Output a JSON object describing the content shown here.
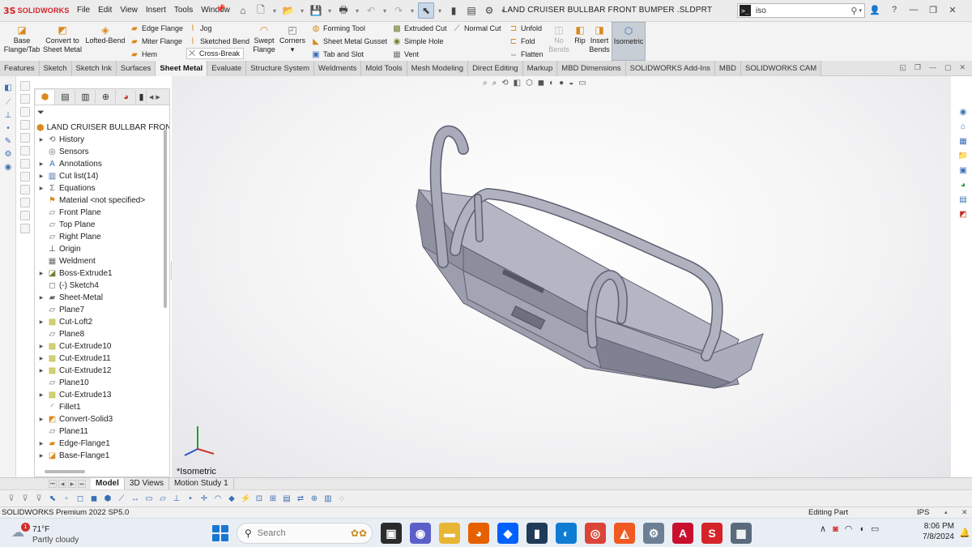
{
  "app": {
    "logo_mark": "3S",
    "logo_text": "SOLIDWORKS",
    "document_title": "LAND CRUISER BULLBAR FRONT BUMPER .SLDPRT"
  },
  "menus": [
    "File",
    "Edit",
    "View",
    "Insert",
    "Tools",
    "Window"
  ],
  "search": {
    "value": "iso",
    "placeholder": ""
  },
  "command_manager": {
    "base_flange": "Base Flange/Tab",
    "convert": "Convert to Sheet Metal",
    "lofted_bend": "Lofted-Bend",
    "edge_flange": "Edge Flange",
    "miter_flange": "Miter Flange",
    "hem": "Hem",
    "jog": "Jog",
    "sketched_bend": "Sketched Bend",
    "cross_break": "Cross-Break",
    "swept_flange": "Swept Flange",
    "corners": "Corners",
    "forming_tool": "Forming Tool",
    "gusset": "Sheet Metal Gusset",
    "tab_slot": "Tab and Slot",
    "extruded_cut": "Extruded Cut",
    "simple_hole": "Simple Hole",
    "vent": "Vent",
    "normal_cut": "Normal Cut",
    "unfold": "Unfold",
    "fold": "Fold",
    "flatten": "Flatten",
    "no_bends": "No Bends",
    "rip": "Rip",
    "insert_bends": "Insert Bends",
    "isometric": "Isometric"
  },
  "tabs": [
    {
      "label": "Features"
    },
    {
      "label": "Sketch"
    },
    {
      "label": "Sketch Ink"
    },
    {
      "label": "Surfaces"
    },
    {
      "label": "Sheet Metal",
      "active": true
    },
    {
      "label": "Evaluate"
    },
    {
      "label": "Structure System"
    },
    {
      "label": "Weldments"
    },
    {
      "label": "Mold Tools"
    },
    {
      "label": "Mesh Modeling"
    },
    {
      "label": "Direct Editing"
    },
    {
      "label": "Markup"
    },
    {
      "label": "MBD Dimensions"
    },
    {
      "label": "SOLIDWORKS Add-Ins"
    },
    {
      "label": "MBD"
    },
    {
      "label": "SOLIDWORKS CAM"
    }
  ],
  "tree": {
    "root": "LAND CRUISER BULLBAR FRONT B",
    "items": [
      {
        "label": "History",
        "icon": "history-icon",
        "exp": true
      },
      {
        "label": "Sensors",
        "icon": "sensors-icon",
        "exp": false
      },
      {
        "label": "Annotations",
        "icon": "annotations-icon",
        "exp": true
      },
      {
        "label": "Cut list(14)",
        "icon": "cutlist-icon",
        "exp": true
      },
      {
        "label": "Equations",
        "icon": "equations-icon",
        "exp": true
      },
      {
        "label": "Material <not specified>",
        "icon": "material-icon",
        "exp": false
      },
      {
        "label": "Front Plane",
        "icon": "plane-icon",
        "exp": false
      },
      {
        "label": "Top Plane",
        "icon": "plane-icon",
        "exp": false
      },
      {
        "label": "Right Plane",
        "icon": "plane-icon",
        "exp": false
      },
      {
        "label": "Origin",
        "icon": "origin-icon",
        "exp": false
      },
      {
        "label": "Weldment",
        "icon": "weldment-icon",
        "exp": false
      },
      {
        "label": "Boss-Extrude1",
        "icon": "boss-extrude-icon",
        "exp": true
      },
      {
        "label": "(-) Sketch4",
        "icon": "sketch-icon",
        "exp": false
      },
      {
        "label": "Sheet-Metal",
        "icon": "sheet-metal-icon",
        "exp": true
      },
      {
        "label": "Plane7",
        "icon": "plane-icon",
        "exp": false
      },
      {
        "label": "Cut-Loft2",
        "icon": "cut-icon",
        "exp": true
      },
      {
        "label": "Plane8",
        "icon": "plane-icon",
        "exp": false
      },
      {
        "label": "Cut-Extrude10",
        "icon": "cut-icon",
        "exp": true
      },
      {
        "label": "Cut-Extrude11",
        "icon": "cut-icon",
        "exp": true
      },
      {
        "label": "Cut-Extrude12",
        "icon": "cut-icon",
        "exp": true
      },
      {
        "label": "Plane10",
        "icon": "plane-icon",
        "exp": false
      },
      {
        "label": "Cut-Extrude13",
        "icon": "cut-icon",
        "exp": true
      },
      {
        "label": "Fillet1",
        "icon": "fillet-icon",
        "exp": false
      },
      {
        "label": "Convert-Solid3",
        "icon": "convert-icon",
        "exp": true
      },
      {
        "label": "Plane11",
        "icon": "plane-icon",
        "exp": false
      },
      {
        "label": "Edge-Flange1",
        "icon": "edge-flange-icon",
        "exp": true
      },
      {
        "label": "Base-Flange1",
        "icon": "base-flange-icon",
        "exp": true
      }
    ]
  },
  "viewport": {
    "view_label": "*Isometric"
  },
  "bottom_tabs": [
    {
      "label": "Model",
      "active": true
    },
    {
      "label": "3D Views"
    },
    {
      "label": "Motion Study 1"
    }
  ],
  "status": {
    "product": "SOLIDWORKS Premium 2022 SP5.0",
    "mode": "Editing Part",
    "units": "IPS"
  },
  "taskbar": {
    "weather_badge": "1",
    "temperature": "71°F",
    "condition": "Partly cloudy",
    "search_placeholder": "Search",
    "time": "8:06 PM",
    "date": "7/8/2024"
  },
  "colors": {
    "accent": "#3a6fb3",
    "brand": "#d5232a",
    "model_fill": "#a7a9b8",
    "model_dark": "#7f8192",
    "active_tab": "#f3f3f3"
  }
}
